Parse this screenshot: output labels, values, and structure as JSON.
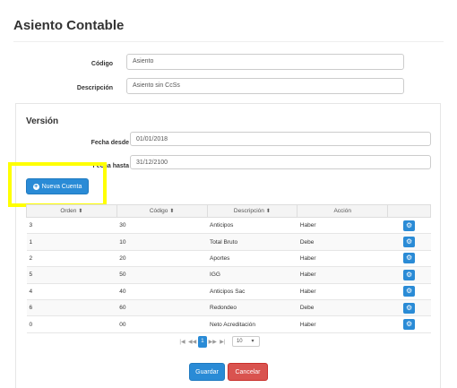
{
  "page": {
    "title": "Asiento Contable"
  },
  "form": {
    "codigo_label": "Código",
    "codigo_value": "Asiento",
    "descripcion_label": "Descripción",
    "descripcion_value": "Asiento sin CcSs"
  },
  "version": {
    "title": "Versión",
    "fecha_desde_label": "Fecha desde",
    "fecha_desde_value": "01/01/2018",
    "fecha_hasta_label": "Fecha hasta",
    "fecha_hasta_value": "31/12/2100",
    "new_account_label": "Nueva Cuenta"
  },
  "table": {
    "columns": [
      "Orden",
      "Código",
      "Descripción",
      "Acción"
    ],
    "rows": [
      {
        "orden": "3",
        "codigo": "30",
        "descripcion": "Anticipos",
        "accion": "Haber"
      },
      {
        "orden": "1",
        "codigo": "10",
        "descripcion": "Total Bruto",
        "accion": "Debe"
      },
      {
        "orden": "2",
        "codigo": "20",
        "descripcion": "Aportes",
        "accion": "Haber"
      },
      {
        "orden": "5",
        "codigo": "50",
        "descripcion": "IGG",
        "accion": "Haber"
      },
      {
        "orden": "4",
        "codigo": "40",
        "descripcion": "Anticipos Sac",
        "accion": "Haber"
      },
      {
        "orden": "6",
        "codigo": "60",
        "descripcion": "Redondeo",
        "accion": "Debe"
      },
      {
        "orden": "0",
        "codigo": "00",
        "descripcion": "Neto Acreditación",
        "accion": "Haber"
      }
    ]
  },
  "pager": {
    "current_page": "1",
    "page_size": "10",
    "first": "|◀",
    "prev": "◀◀",
    "next": "▶▶",
    "last": "▶|"
  },
  "actions": {
    "save_label": "Guardar",
    "cancel_label": "Cancelar"
  },
  "colors": {
    "primary": "#2a8bd6",
    "danger": "#d9534f",
    "highlight": "#ffff00"
  }
}
